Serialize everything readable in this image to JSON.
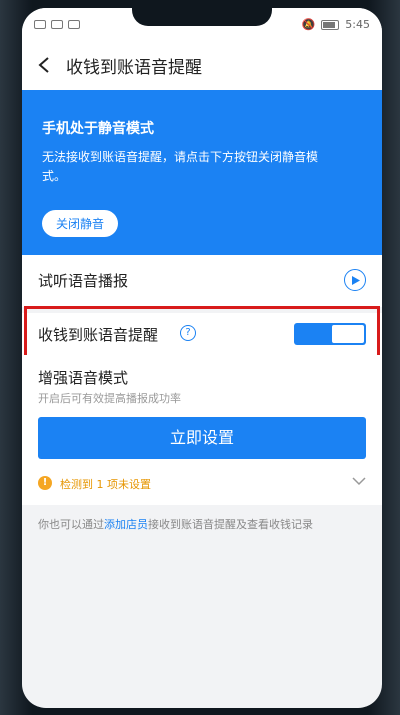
{
  "status_bar": {
    "time": "5:45"
  },
  "header": {
    "title": "收钱到账语音提醒"
  },
  "banner": {
    "title": "手机处于静音模式",
    "description": "无法接收到账语音提醒，请点击下方按钮关闭静音模式。",
    "button_label": "关闭静音"
  },
  "rows": {
    "preview_label": "试听语音播报",
    "voice_reminder_label": "收钱到账语音提醒",
    "voice_reminder_enabled": true
  },
  "enhance": {
    "title": "增强语音模式",
    "subtitle": "开启后可有效提高播报成功率",
    "button_label": "立即设置",
    "detect_text": "检测到 1 项未设置"
  },
  "footer": {
    "prefix": "你也可以通过",
    "link": "添加店员",
    "suffix": "接收到账语音提醒及查看收钱记录"
  },
  "colors": {
    "accent": "#1b82f3",
    "warning": "#f5a623",
    "highlight": "#d81b1b"
  }
}
